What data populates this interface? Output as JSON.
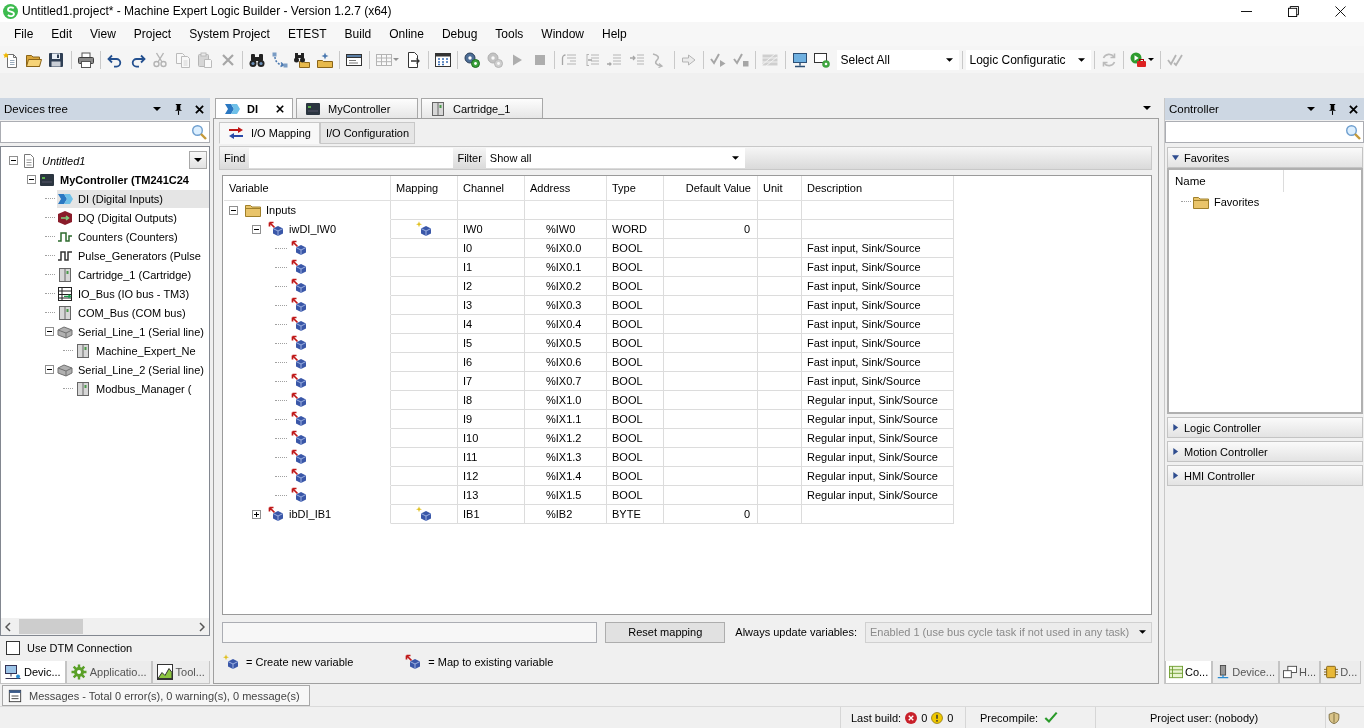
{
  "window": {
    "title": "Untitled1.project* - Machine Expert Logic Builder - Version 1.2.7 (x64)"
  },
  "menu": [
    "File",
    "Edit",
    "View",
    "Project",
    "System Project",
    "ETEST",
    "Build",
    "Online",
    "Debug",
    "Tools",
    "Window",
    "Help"
  ],
  "toolbar": {
    "groups": [
      [
        {
          "kind": "new",
          "disabled": false
        },
        {
          "kind": "open",
          "disabled": false
        },
        {
          "kind": "save",
          "disabled": false
        }
      ],
      [
        {
          "kind": "print",
          "disabled": false
        }
      ],
      [
        {
          "kind": "undo",
          "disabled": false
        },
        {
          "kind": "redo",
          "disabled": false
        },
        {
          "kind": "cut",
          "disabled": true
        },
        {
          "kind": "copy",
          "disabled": true
        },
        {
          "kind": "paste",
          "disabled": true
        },
        {
          "kind": "delete",
          "disabled": true
        }
      ],
      [
        {
          "kind": "find",
          "disabled": false
        },
        {
          "kind": "replace",
          "disabled": false
        },
        {
          "kind": "findfolder",
          "disabled": false
        },
        {
          "kind": "editfolder",
          "disabled": false
        }
      ],
      [
        {
          "kind": "window",
          "disabled": false
        }
      ],
      [
        {
          "kind": "table",
          "disabled": true
        },
        {
          "kind": "export",
          "disabled": false
        }
      ],
      [
        {
          "kind": "grid",
          "disabled": false
        }
      ],
      [
        {
          "kind": "login",
          "disabled": false
        },
        {
          "kind": "logout",
          "disabled": true
        },
        {
          "kind": "play",
          "disabled": true
        },
        {
          "kind": "stop",
          "disabled": true
        }
      ],
      [
        {
          "kind": "stepover",
          "disabled": true
        },
        {
          "kind": "stepin",
          "disabled": true
        },
        {
          "kind": "stepout",
          "disabled": true
        },
        {
          "kind": "cursor",
          "disabled": true
        },
        {
          "kind": "nextstatement",
          "disabled": true
        }
      ],
      [
        {
          "kind": "arrow",
          "disabled": true
        }
      ],
      [
        {
          "kind": "tickplay",
          "disabled": true
        },
        {
          "kind": "tickstop",
          "disabled": true
        }
      ],
      [
        {
          "kind": "striped",
          "disabled": true
        }
      ],
      [
        {
          "kind": "monitor",
          "disabled": false
        },
        {
          "kind": "monitorgear",
          "disabled": false
        }
      ]
    ],
    "selection_dropdown": "Select All",
    "configuration_dropdown": "Logic Configuratic",
    "trailing_groups": [
      [
        {
          "kind": "refresh",
          "disabled": true
        }
      ],
      [
        {
          "kind": "playtoolbox",
          "disabled": false
        }
      ],
      [
        {
          "kind": "doubletick",
          "disabled": true
        }
      ]
    ]
  },
  "devices_panel": {
    "title": "Devices tree",
    "tree": [
      {
        "label": "Untitled1",
        "kind": "project",
        "expanded": true,
        "selected": false,
        "children": [
          {
            "label": "MyController (TM241C24",
            "kind": "controller",
            "expanded": true,
            "selected": false,
            "children": [
              {
                "label": "DI (Digital Inputs)",
                "kind": "input",
                "selected": true
              },
              {
                "label": "DQ (Digital Outputs)",
                "kind": "output",
                "selected": false
              },
              {
                "label": "Counters (Counters)",
                "kind": "counter",
                "selected": false
              },
              {
                "label": "Pulse_Generators (Pulse",
                "kind": "pulse",
                "selected": false
              },
              {
                "label": "Cartridge_1 (Cartridge)",
                "kind": "module",
                "selected": false
              },
              {
                "label": "IO_Bus (IO bus - TM3)",
                "kind": "bus",
                "selected": false
              },
              {
                "label": "COM_Bus (COM bus)",
                "kind": "module",
                "selected": false
              },
              {
                "label": "Serial_Line_1 (Serial line)",
                "kind": "serial",
                "expanded": true,
                "selected": false,
                "children": [
                  {
                    "label": "Machine_Expert_Ne",
                    "kind": "module",
                    "selected": false
                  }
                ]
              },
              {
                "label": "Serial_Line_2 (Serial line)",
                "kind": "serial",
                "expanded": true,
                "selected": false,
                "children": [
                  {
                    "label": "Modbus_Manager (",
                    "kind": "module",
                    "selected": false
                  }
                ]
              }
            ]
          }
        ]
      }
    ],
    "use_dtm_connection": {
      "label": "Use DTM Connection",
      "checked": false
    },
    "tabs": [
      {
        "label": "Devic...",
        "kind": "devices",
        "selected": true
      },
      {
        "label": "Applicatio...",
        "kind": "applications",
        "selected": false
      },
      {
        "label": "Tool...",
        "kind": "tools",
        "selected": false
      }
    ]
  },
  "editor": {
    "tabs": [
      {
        "label": "DI",
        "kind": "input",
        "selected": true
      },
      {
        "label": "MyController",
        "kind": "controller",
        "selected": false
      },
      {
        "label": "Cartridge_1",
        "kind": "module",
        "selected": false
      }
    ],
    "subtabs": [
      {
        "label": "I/O Mapping",
        "kind": "mapping",
        "selected": true
      },
      {
        "label": "I/O Configuration",
        "kind": "configuration",
        "selected": false
      }
    ],
    "find_label": "Find",
    "filter": {
      "label": "Filter",
      "value": "Show all"
    },
    "table": {
      "columns": [
        "Variable",
        "Mapping",
        "Channel",
        "Address",
        "Type",
        "Default Value",
        "Unit",
        "Description"
      ],
      "rows": [
        {
          "variable": "Inputs",
          "kind": "folder",
          "expanded": true,
          "children": [
            {
              "variable": "iwDI_IW0",
              "kind": "channel",
              "mapping": {
                "kind": "new"
              },
              "channel": "IW0",
              "address": "%IW0",
              "type": "WORD",
              "default_value": "0",
              "expanded": true,
              "children": [
                {
                  "kind": "channel",
                  "channel": "I0",
                  "address": "%IX0.0",
                  "type": "BOOL",
                  "description": "Fast input, Sink/Source"
                },
                {
                  "kind": "channel",
                  "channel": "I1",
                  "address": "%IX0.1",
                  "type": "BOOL",
                  "description": "Fast input, Sink/Source"
                },
                {
                  "kind": "channel",
                  "channel": "I2",
                  "address": "%IX0.2",
                  "type": "BOOL",
                  "description": "Fast input, Sink/Source"
                },
                {
                  "kind": "channel",
                  "channel": "I3",
                  "address": "%IX0.3",
                  "type": "BOOL",
                  "description": "Fast input, Sink/Source"
                },
                {
                  "kind": "channel",
                  "channel": "I4",
                  "address": "%IX0.4",
                  "type": "BOOL",
                  "description": "Fast input, Sink/Source"
                },
                {
                  "kind": "channel",
                  "channel": "I5",
                  "address": "%IX0.5",
                  "type": "BOOL",
                  "description": "Fast input, Sink/Source"
                },
                {
                  "kind": "channel",
                  "channel": "I6",
                  "address": "%IX0.6",
                  "type": "BOOL",
                  "description": "Fast input, Sink/Source"
                },
                {
                  "kind": "channel",
                  "channel": "I7",
                  "address": "%IX0.7",
                  "type": "BOOL",
                  "description": "Fast input, Sink/Source"
                },
                {
                  "kind": "channel",
                  "channel": "I8",
                  "address": "%IX1.0",
                  "type": "BOOL",
                  "description": "Regular input, Sink/Source"
                },
                {
                  "kind": "channel",
                  "channel": "I9",
                  "address": "%IX1.1",
                  "type": "BOOL",
                  "description": "Regular input, Sink/Source"
                },
                {
                  "kind": "channel",
                  "channel": "I10",
                  "address": "%IX1.2",
                  "type": "BOOL",
                  "description": "Regular input, Sink/Source"
                },
                {
                  "kind": "channel",
                  "channel": "I11",
                  "address": "%IX1.3",
                  "type": "BOOL",
                  "description": "Regular input, Sink/Source"
                },
                {
                  "kind": "channel",
                  "channel": "I12",
                  "address": "%IX1.4",
                  "type": "BOOL",
                  "description": "Regular input, Sink/Source"
                },
                {
                  "kind": "channel",
                  "channel": "I13",
                  "address": "%IX1.5",
                  "type": "BOOL",
                  "description": "Regular input, Sink/Source"
                }
              ]
            },
            {
              "variable": "ibDI_IB1",
              "kind": "channel",
              "mapping": {
                "kind": "new"
              },
              "channel": "IB1",
              "address": "%IB2",
              "type": "BYTE",
              "default_value": "0",
              "expanded": false
            }
          ]
        }
      ]
    },
    "reset_button": "Reset mapping",
    "always_update": {
      "label": "Always update variables:",
      "value": "Enabled 1 (use bus cycle task if not used in any task)",
      "disabled": true
    },
    "legend": [
      {
        "kind": "new",
        "text": "= Create new variable"
      },
      {
        "kind": "existing",
        "text": "= Map to existing variable"
      }
    ]
  },
  "controller_panel": {
    "title": "Controller",
    "sections": [
      {
        "title": "Favorites",
        "expanded": true,
        "column": "Name",
        "items": [
          {
            "label": "Favorites",
            "kind": "folder"
          }
        ]
      },
      {
        "title": "Logic Controller",
        "expanded": false
      },
      {
        "title": "Motion Controller",
        "expanded": false
      },
      {
        "title": "HMI Controller",
        "expanded": false
      }
    ],
    "tabs": [
      {
        "label": "Co...",
        "kind": "catalog",
        "selected": true
      },
      {
        "label": "Device...",
        "kind": "device",
        "selected": false
      },
      {
        "label": "H...",
        "kind": "windows",
        "selected": false
      },
      {
        "label": "D...",
        "kind": "chip",
        "selected": false
      }
    ]
  },
  "messages": {
    "label": "Messages - Total 0 error(s), 0 warning(s), 0 message(s)"
  },
  "status_bar": {
    "last_build_label": "Last build:",
    "errors": "0",
    "warnings": "0",
    "precompile_label": "Precompile:",
    "precompile_ok": true,
    "project_user": "Project user: (nobody)"
  }
}
